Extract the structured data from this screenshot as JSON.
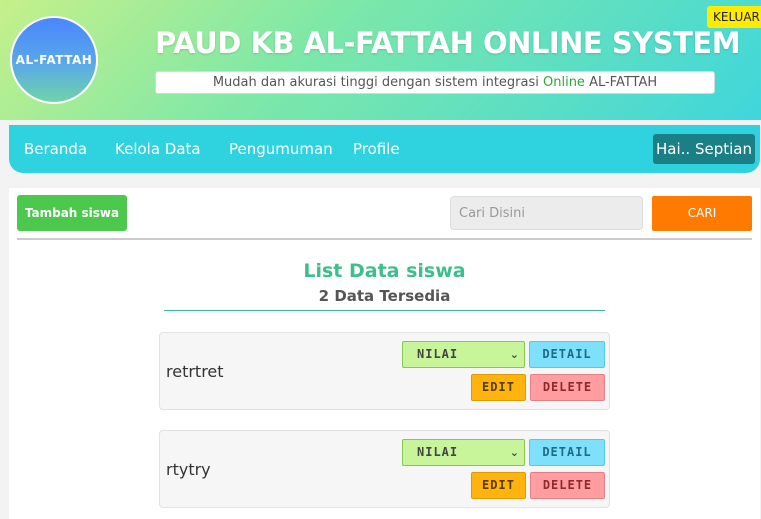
{
  "header": {
    "logo_text": "AL-FATTAH",
    "title": "PAUD KB AL-FATTAH ONLINE SYSTEM",
    "tagline_before": "Mudah dan akurasi tinggi dengan sistem integrasi ",
    "tagline_highlight": "Online",
    "tagline_after": " AL-FATTAH",
    "logout_label": "KELUAR"
  },
  "nav": {
    "items": [
      {
        "label": "Beranda"
      },
      {
        "label": "Kelola Data"
      },
      {
        "label": "Pengumuman"
      },
      {
        "label": "Profile"
      }
    ],
    "user_greeting": "Hai.. Septian"
  },
  "toolbar": {
    "add_label": "Tambah siswa",
    "search_placeholder": "Cari Disini",
    "search_button": "CARI"
  },
  "list": {
    "title": "List Data siswa",
    "count_label": "2 Data Tersedia",
    "rows": [
      {
        "name": "retrtret",
        "select_value": "NILAI",
        "detail": "DETAIL",
        "edit": "EDIT",
        "delete": "DELETE"
      },
      {
        "name": "rtytry",
        "select_value": "NILAI",
        "detail": "DETAIL",
        "edit": "EDIT",
        "delete": "DELETE"
      }
    ]
  },
  "colors": {
    "nav_bg": "#2fd3e0",
    "add_button": "#4cc94c",
    "search_button": "#ff7a00",
    "list_title": "#3cbf8c",
    "logout_bg": "#ffeb00"
  },
  "icons": {
    "select_arrow": "chevron-down-icon"
  }
}
